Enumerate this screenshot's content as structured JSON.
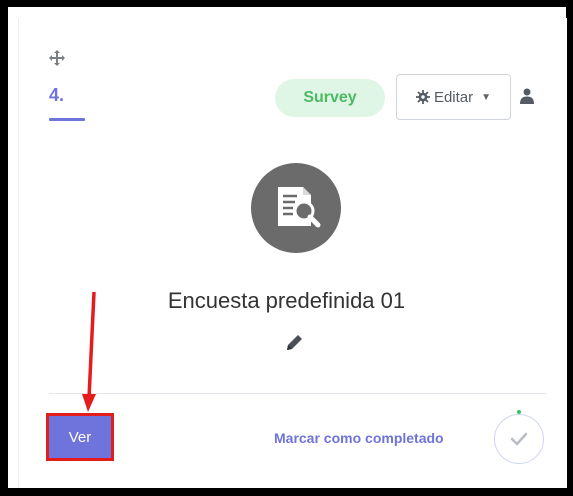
{
  "card": {
    "step_number": "4.",
    "type_badge": "Survey",
    "edit_label": "Editar",
    "title": "Encuesta predefinida 01",
    "view_label": "Ver",
    "mark_complete_label": "Marcar como completado"
  },
  "icons": {
    "drag": "move-arrows-icon",
    "edit": "gear-icon",
    "edit_caret": "caret-down-icon",
    "user": "user-icon",
    "activity": "survey-document-search-icon",
    "rename": "pencil-icon",
    "complete": "checkmark-icon"
  },
  "colors": {
    "accent": "#6e74db",
    "badge_bg": "#dff5e5",
    "badge_text": "#4bba64",
    "annotation": "#e51c1c",
    "icon_circle": "#6b6b6b"
  }
}
